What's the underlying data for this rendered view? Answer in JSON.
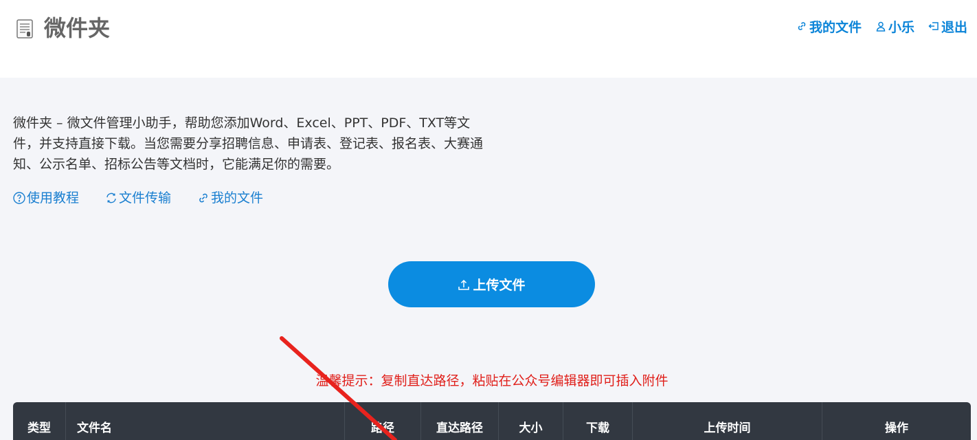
{
  "header": {
    "brand": "微件夹",
    "nav": [
      {
        "icon": "link-icon",
        "label": "我的文件"
      },
      {
        "icon": "user-icon",
        "label": "小乐"
      },
      {
        "icon": "logout-icon",
        "label": "退出"
      }
    ]
  },
  "main": {
    "description": "微件夹 – 微文件管理小助手，帮助您添加Word、Excel、PPT、PDF、TXT等文件，并支持直接下载。当您需要分享招聘信息、申请表、登记表、报名表、大赛通知、公示名单、招标公告等文档时，它能满足你的需要。",
    "links": [
      {
        "icon": "help-icon",
        "label": "使用教程"
      },
      {
        "icon": "refresh-icon",
        "label": "文件传输"
      },
      {
        "icon": "link-icon",
        "label": "我的文件"
      }
    ],
    "upload_label": "上传文件",
    "tip": "温馨提示：复制直达路径，粘贴在公众号编辑器即可插入附件"
  },
  "table": {
    "columns": [
      "类型",
      "文件名",
      "路径",
      "直达路径",
      "大小",
      "下载",
      "上传时间",
      "操作"
    ]
  },
  "colors": {
    "accent": "#0b8ce1",
    "link": "#0b84d8",
    "tip": "#e0201b",
    "table_header": "#323841",
    "annotation_arrow": "#e8231e"
  }
}
